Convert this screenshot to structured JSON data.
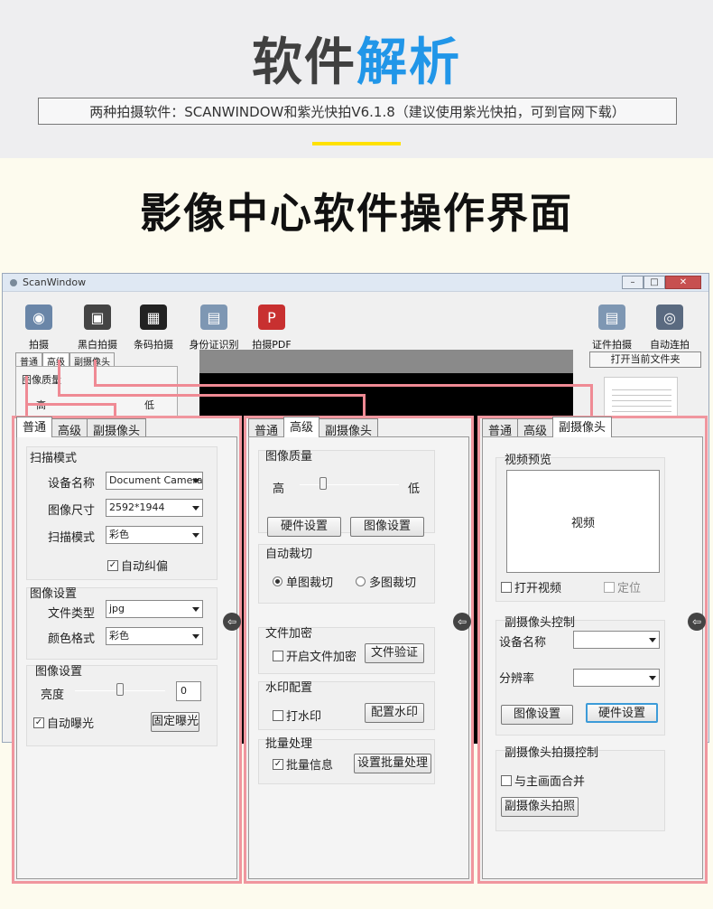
{
  "header": {
    "title_part1": "软件",
    "title_part2": "解析",
    "subtitle": "两种拍摄软件：SCANWINDOW和紫光快拍V6.1.8（建议使用紫光快拍，可到官网下载）",
    "section_title": "影像中心软件操作界面"
  },
  "window": {
    "title": "ScanWindow",
    "controls": {
      "minimize": "–",
      "maximize": "□",
      "close": "✕"
    },
    "toolbar_left": [
      "拍摄",
      "黑白拍摄",
      "条码拍摄",
      "身份证识别",
      "拍摄PDF"
    ],
    "toolbar_right": [
      "证件拍摄",
      "自动连拍"
    ],
    "tabs": [
      "普通",
      "高级",
      "副摄像头"
    ],
    "bg_group": "图像质量",
    "bg_high": "高",
    "bg_low": "低",
    "open_folder_label": "打开当前文件夹"
  },
  "panel_general": {
    "tabs": [
      "普通",
      "高级",
      "副摄像头"
    ],
    "scan_group": "扫描模式",
    "device_label": "设备名称",
    "device_value": "Document Camera",
    "size_label": "图像尺寸",
    "size_value": "2592*1944",
    "mode_label": "扫描模式",
    "mode_value": "彩色",
    "deskew_label": "自动纠偏",
    "deskew_checked": true,
    "img_group": "图像设置",
    "filetype_label": "文件类型",
    "filetype_value": "jpg",
    "color_label": "颜色格式",
    "color_value": "彩色",
    "img_group2": "图像设置",
    "brightness_label": "亮度",
    "brightness_value": "0",
    "autoexp_label": "自动曝光",
    "autoexp_checked": true,
    "fixexp_label": "固定曝光"
  },
  "panel_advanced": {
    "tabs": [
      "普通",
      "高级",
      "副摄像头"
    ],
    "quality_group": "图像质量",
    "high": "高",
    "low": "低",
    "hw_button": "硬件设置",
    "img_button": "图像设置",
    "crop_group": "自动裁切",
    "single_crop": "单图裁切",
    "multi_crop": "多图裁切",
    "encrypt_group": "文件加密",
    "encrypt_label": "开启文件加密",
    "verify_button": "文件验证",
    "watermark_group": "水印配置",
    "watermark_label": "打水印",
    "watermark_button": "配置水印",
    "batch_group": "批量处理",
    "batch_label": "批量信息",
    "batch_checked": true,
    "batch_button": "设置批量处理"
  },
  "panel_camera": {
    "tabs": [
      "普通",
      "高级",
      "副摄像头"
    ],
    "preview_group": "视频预览",
    "video_text": "视频",
    "open_video": "打开视频",
    "locate": "定位",
    "control_group": "副摄像头控制",
    "device_label": "设备名称",
    "resolution_label": "分辨率",
    "img_button": "图像设置",
    "hw_button": "硬件设置",
    "capture_group": "副摄像头拍摄控制",
    "merge_label": "与主画面合并",
    "capture_button": "副摄像头拍照"
  },
  "colors": {
    "accent_blue": "#2196e8",
    "highlight_border": "#f0969e",
    "yellow_bar": "#ffe100"
  }
}
